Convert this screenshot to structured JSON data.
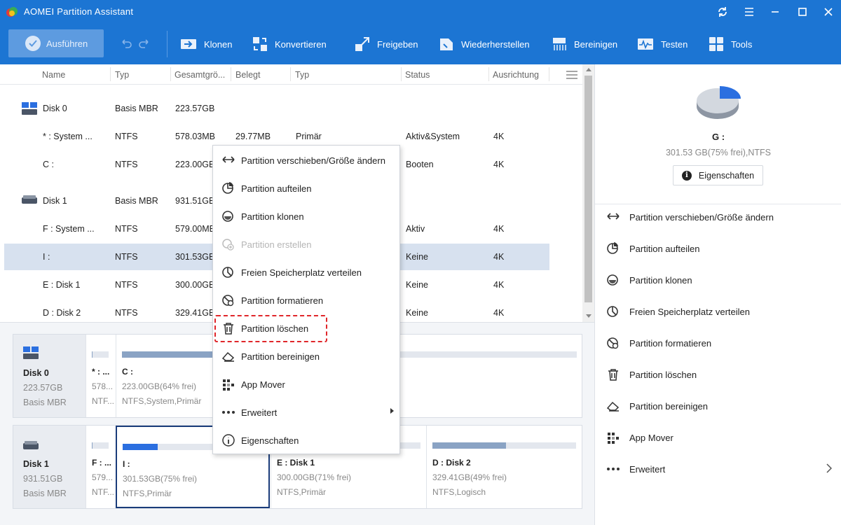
{
  "window": {
    "title": "AOMEI Partition Assistant"
  },
  "toolbar": {
    "run_label": "Ausführen",
    "tools": [
      {
        "label": "Klonen",
        "icon": "clone-icon"
      },
      {
        "label": "Konvertieren",
        "icon": "convert-icon"
      },
      {
        "label": "Freigeben",
        "icon": "free-up-icon"
      },
      {
        "label": "Wiederherstellen",
        "icon": "restore-icon"
      },
      {
        "label": "Bereinigen",
        "icon": "wipe-icon"
      },
      {
        "label": "Testen",
        "icon": "test-icon"
      },
      {
        "label": "Tools",
        "icon": "tools-icon"
      }
    ]
  },
  "table": {
    "headers": [
      "Name",
      "Typ",
      "Gesamtgrö...",
      "Belegt",
      "Typ",
      "Status",
      "Ausrichtung"
    ],
    "rows": [
      {
        "name": "Disk 0",
        "typ": "Basis MBR",
        "size": "223.57GB",
        "used": "",
        "ptype": "",
        "status": "",
        "align": "",
        "disk": true
      },
      {
        "name": "* : System ...",
        "typ": "NTFS",
        "size": "578.03MB",
        "used": "29.77MB",
        "ptype": "Primär",
        "status": "Aktiv&System",
        "align": "4K"
      },
      {
        "name": "C :",
        "typ": "NTFS",
        "size": "223.00GB",
        "used": "",
        "ptype": "",
        "status": "Booten",
        "align": "4K"
      },
      {
        "name": "Disk 1",
        "typ": "Basis MBR",
        "size": "931.51GB",
        "used": "",
        "ptype": "",
        "status": "",
        "align": "",
        "disk": true
      },
      {
        "name": "F : System ...",
        "typ": "NTFS",
        "size": "579.00MB",
        "used": "",
        "ptype": "",
        "status": "Aktiv",
        "align": "4K"
      },
      {
        "name": "I :",
        "typ": "NTFS",
        "size": "301.53GB",
        "used": "",
        "ptype": "",
        "status": "Keine",
        "align": "4K",
        "selected": true
      },
      {
        "name": "E : Disk 1",
        "typ": "NTFS",
        "size": "300.00GB",
        "used": "",
        "ptype": "",
        "status": "Keine",
        "align": "4K"
      },
      {
        "name": "D : Disk 2",
        "typ": "NTFS",
        "size": "329.41GB",
        "used": "",
        "ptype": "",
        "status": "Keine",
        "align": "4K"
      }
    ]
  },
  "disk_map": {
    "disk0": {
      "name": "Disk 0",
      "size": "223.57GB",
      "type": "Basis MBR",
      "partitions": [
        {
          "name": "* : ...",
          "size": "578...",
          "fs": "NTF...",
          "used_fraction": 0.05
        },
        {
          "name": "C :",
          "size": "223.00GB(64% frei)",
          "fs": "NTFS,System,Primär",
          "used_fraction": 0.36
        }
      ]
    },
    "disk1": {
      "name": "Disk 1",
      "size": "931.51GB",
      "type": "Basis MBR",
      "partitions": [
        {
          "name": "F : ...",
          "size": "579...",
          "fs": "NTF...",
          "used_fraction": 0.05
        },
        {
          "name": "I :",
          "size": "301.53GB(75% frei)",
          "fs": "NTFS,Primär",
          "used_fraction": 0.25,
          "selected": true
        },
        {
          "name": "E : Disk 1",
          "size": "300.00GB(71% frei)",
          "fs": "NTFS,Primär",
          "used_fraction": 0.29
        },
        {
          "name": "D : Disk 2",
          "size": "329.41GB(49% frei)",
          "fs": "NTFS,Logisch",
          "used_fraction": 0.51
        }
      ]
    }
  },
  "context_menu": {
    "items": [
      {
        "label": "Partition verschieben/Größe ändern",
        "icon": "resize-icon"
      },
      {
        "label": "Partition aufteilen",
        "icon": "split-icon"
      },
      {
        "label": "Partition klonen",
        "icon": "clone-partition-icon"
      },
      {
        "label": "Partition erstellen",
        "icon": "create-partition-icon",
        "disabled": true
      },
      {
        "label": "Freien Speicherplatz verteilen",
        "icon": "allocate-icon"
      },
      {
        "label": "Partition formatieren",
        "icon": "format-icon"
      },
      {
        "label": "Partition löschen",
        "icon": "delete-icon",
        "highlighted": true
      },
      {
        "label": "Partition bereinigen",
        "icon": "wipe-partition-icon"
      },
      {
        "label": "App Mover",
        "icon": "app-mover-icon"
      },
      {
        "label": "Erweitert",
        "icon": "more-icon",
        "submenu": true
      },
      {
        "label": "Eigenschaften",
        "icon": "info-icon"
      }
    ]
  },
  "right_panel": {
    "selected_label": "G :",
    "selected_info": "301.53 GB(75% frei),NTFS",
    "properties_button": "Eigenschaften",
    "used_fraction": 0.25,
    "operations": [
      {
        "label": "Partition verschieben/Größe ändern"
      },
      {
        "label": "Partition aufteilen"
      },
      {
        "label": "Partition klonen"
      },
      {
        "label": "Freien Speicherplatz verteilen"
      },
      {
        "label": "Partition formatieren"
      },
      {
        "label": "Partition löschen"
      },
      {
        "label": "Partition bereinigen"
      },
      {
        "label": "App Mover"
      },
      {
        "label": "Erweitert"
      }
    ]
  },
  "colors": {
    "titlebar": "#1c75d3",
    "selection": "#d7e1ef",
    "highlight_border": "#e0262a",
    "accent": "#2b6fe0"
  }
}
